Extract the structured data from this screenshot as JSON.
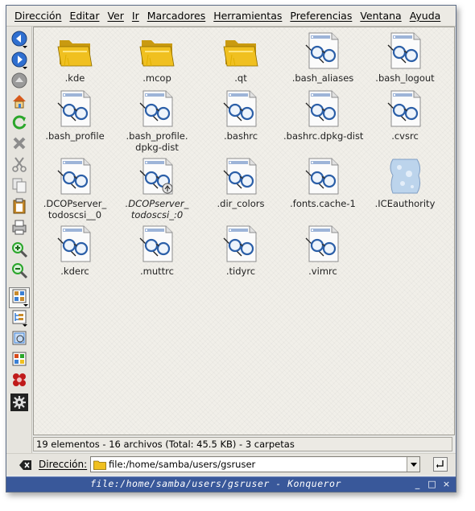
{
  "menubar": {
    "items": [
      "Dirección",
      "Editar",
      "Ver",
      "Ir",
      "Marcadores",
      "Herramientas",
      "Preferencias",
      "Ventana",
      "Ayuda"
    ]
  },
  "toolbar": {
    "buttons": [
      {
        "name": "back-icon",
        "color": "#2f6fd0"
      },
      {
        "name": "forward-icon",
        "color": "#2f6fd0"
      },
      {
        "name": "up-icon",
        "color": "#9a9a9a"
      },
      {
        "name": "home-icon",
        "color": "#d65a1c"
      },
      {
        "name": "reload-icon",
        "color": "#2aa62a"
      },
      {
        "name": "stop-icon",
        "color": "#8c8c8c"
      },
      {
        "name": "cut-icon",
        "color": "#8c8c8c"
      },
      {
        "name": "copy-icon",
        "color": "#8c8c8c"
      },
      {
        "name": "paste-icon",
        "color": "#c98b2b"
      },
      {
        "name": "print-icon",
        "color": "#8c8c8c"
      },
      {
        "name": "zoom-in-icon",
        "color": "#2aa62a"
      },
      {
        "name": "zoom-out-icon",
        "color": "#2aa62a"
      },
      {
        "name": "icon-view-icon",
        "color": "#c98b2b"
      },
      {
        "name": "tree-view-icon",
        "color": "#3a7fd4"
      },
      {
        "name": "preview-icon",
        "color": "#3a7fd4"
      },
      {
        "name": "multicolumn-view-icon",
        "color": "#3a7fd4"
      },
      {
        "name": "konqueror-gears-icon",
        "color": "#c01a1a"
      },
      {
        "name": "settings-gear-icon",
        "color": "#222222"
      }
    ]
  },
  "files": [
    {
      "name": ".kde",
      "type": "folder"
    },
    {
      "name": ".mcop",
      "type": "folder"
    },
    {
      "name": ".qt",
      "type": "folder"
    },
    {
      "name": ".bash_aliases",
      "type": "text"
    },
    {
      "name": ".bash_logout",
      "type": "text"
    },
    {
      "name": ".bash_profile",
      "type": "text"
    },
    {
      "name": ".bash_profile.",
      "name2": "dpkg-dist",
      "type": "text"
    },
    {
      "name": ".bashrc",
      "type": "text"
    },
    {
      "name": ".bashrc.dpkg-dist",
      "type": "text"
    },
    {
      "name": ".cvsrc",
      "type": "text"
    },
    {
      "name": ".DCOPserver_",
      "name2": "todoscsi__0",
      "type": "text"
    },
    {
      "name": ".DCOPserver_",
      "name2": "todoscsi_:0",
      "type": "link"
    },
    {
      "name": ".dir_colors",
      "type": "text"
    },
    {
      "name": ".fonts.cache-1",
      "type": "text"
    },
    {
      "name": ".ICEauthority",
      "type": "blob"
    },
    {
      "name": ".kderc",
      "type": "text"
    },
    {
      "name": ".muttrc",
      "type": "text"
    },
    {
      "name": ".tidyrc",
      "type": "text"
    },
    {
      "name": ".vimrc",
      "type": "text"
    }
  ],
  "status": {
    "text": "19 elementos - 16 archivos (Total: 45.5 KB) - 3 carpetas"
  },
  "location": {
    "label": "Dirección:",
    "value": "file:/home/samba/users/gsruser"
  },
  "window": {
    "title": "file:/home/samba/users/gsruser - Konqueror",
    "controls": [
      "_",
      "□",
      "×"
    ]
  },
  "colors": {
    "titlebar": "#39589a",
    "folder": "#f0c020",
    "glasses": "#2b5fa8"
  }
}
